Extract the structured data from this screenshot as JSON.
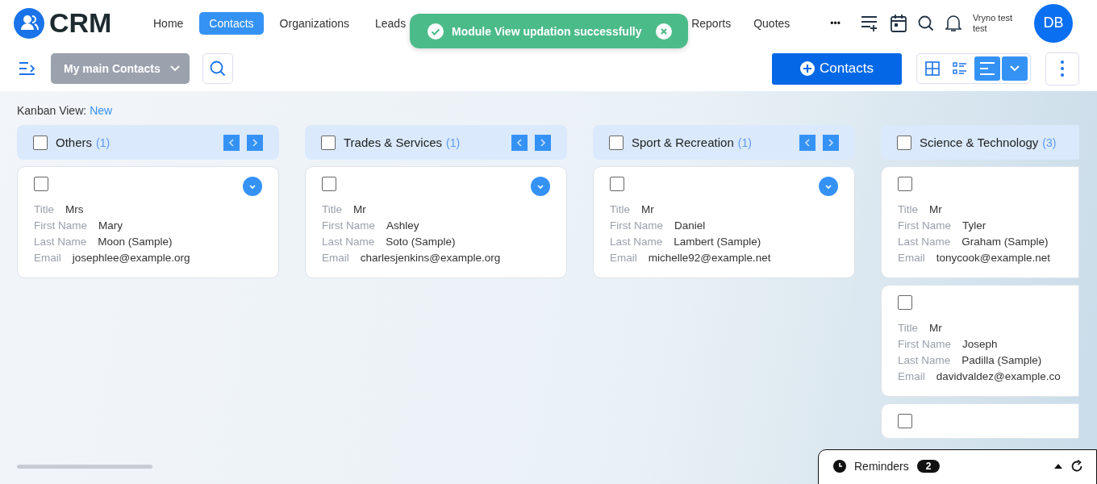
{
  "logo": {
    "text": "CRM"
  },
  "nav": {
    "left": [
      {
        "label": "Home",
        "selected": false
      },
      {
        "label": "Contacts",
        "selected": true
      },
      {
        "label": "Organizations",
        "selected": false
      },
      {
        "label": "Leads",
        "selected": false
      }
    ],
    "right": [
      {
        "label": "Reports",
        "selected": false
      },
      {
        "label": "Quotes",
        "selected": false
      }
    ],
    "more": "•••"
  },
  "user": {
    "name": "Vryno test test",
    "initials": "DB"
  },
  "toast": {
    "message": "Module View updation successfully"
  },
  "toolbar": {
    "view_select": "My main Contacts",
    "add_button": "Contacts",
    "views": [
      {
        "kind": "grid",
        "selected": false
      },
      {
        "kind": "list",
        "selected": false
      },
      {
        "kind": "kanban",
        "selected": true
      }
    ]
  },
  "view_label": {
    "label": "Kanban View:",
    "value": "New"
  },
  "columns": [
    {
      "title": "Others",
      "count": "(1)",
      "checked": false,
      "arrows": true,
      "cards": [
        {
          "checked": false,
          "menu": true,
          "fields": [
            [
              "Title",
              "Mrs"
            ],
            [
              "First Name",
              "Mary"
            ],
            [
              "Last Name",
              "Moon (Sample)"
            ],
            [
              "Email",
              "josephlee@example.org"
            ]
          ]
        }
      ]
    },
    {
      "title": "Trades & Services",
      "count": "(1)",
      "checked": false,
      "arrows": true,
      "cards": [
        {
          "checked": false,
          "menu": true,
          "fields": [
            [
              "Title",
              "Mr"
            ],
            [
              "First Name",
              "Ashley"
            ],
            [
              "Last Name",
              "Soto (Sample)"
            ],
            [
              "Email",
              "charlesjenkins@example.org"
            ]
          ]
        }
      ]
    },
    {
      "title": "Sport & Recreation",
      "count": "(1)",
      "checked": false,
      "arrows": true,
      "cards": [
        {
          "checked": false,
          "menu": true,
          "fields": [
            [
              "Title",
              "Mr"
            ],
            [
              "First Name",
              "Daniel"
            ],
            [
              "Last Name",
              "Lambert (Sample)"
            ],
            [
              "Email",
              "michelle92@example.net"
            ]
          ]
        }
      ]
    },
    {
      "title": "Science & Technology",
      "count": "(3)",
      "checked": false,
      "arrows": false,
      "cards": [
        {
          "checked": false,
          "menu": false,
          "fields": [
            [
              "Title",
              "Mr"
            ],
            [
              "First Name",
              "Tyler"
            ],
            [
              "Last Name",
              "Graham (Sample)"
            ],
            [
              "Email",
              "tonycook@example.net"
            ]
          ]
        },
        {
          "checked": false,
          "menu": false,
          "fields": [
            [
              "Title",
              "Mr"
            ],
            [
              "First Name",
              "Joseph"
            ],
            [
              "Last Name",
              "Padilla (Sample)"
            ],
            [
              "Email",
              "davidvaldez@example.co"
            ]
          ]
        },
        {
          "checked": false,
          "menu": false
        }
      ]
    }
  ],
  "reminders": {
    "label": "Reminders",
    "count": "2"
  }
}
